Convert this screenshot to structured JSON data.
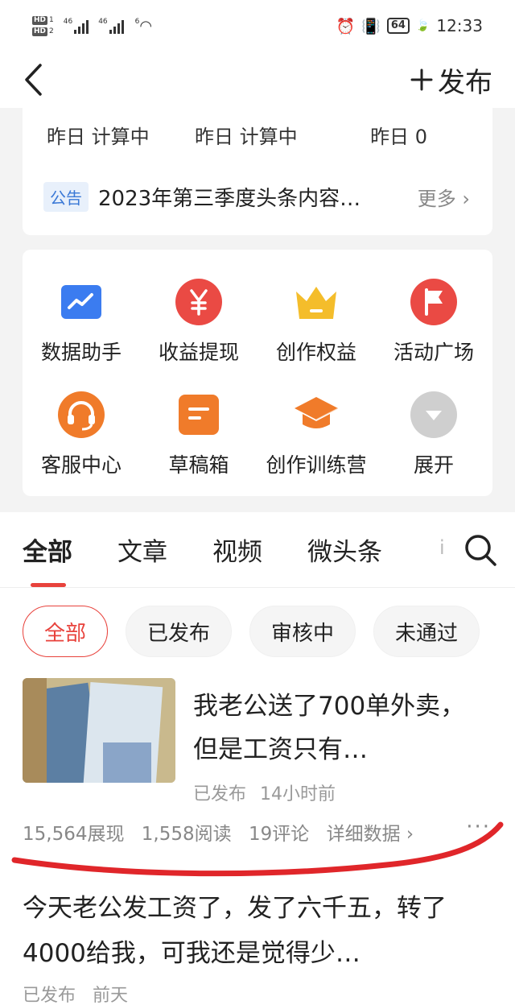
{
  "status_bar": {
    "hd1": "HD",
    "hd1_num": "1",
    "hd2": "HD",
    "hd2_num": "2",
    "sig1_label": "46",
    "sig2_label": "46",
    "wifi_label": "6",
    "battery": "64",
    "time": "12:33"
  },
  "nav": {
    "publish_label": "发布"
  },
  "stats": [
    {
      "label": "昨日 计算中"
    },
    {
      "label": "昨日 计算中"
    },
    {
      "label": "昨日 0"
    }
  ],
  "notice": {
    "tag": "公告",
    "text": "2023年第三季度头条内容…",
    "more": "更多"
  },
  "tools": [
    {
      "label": "数据助手",
      "icon": "chart-icon",
      "color": "#3b7cf0"
    },
    {
      "label": "收益提现",
      "icon": "yuan-icon",
      "color": "#ea4a44"
    },
    {
      "label": "创作权益",
      "icon": "crown-icon",
      "color": "#f4bd2b"
    },
    {
      "label": "活动广场",
      "icon": "flag-icon",
      "color": "#ea4a44"
    },
    {
      "label": "客服中心",
      "icon": "headset-icon",
      "color": "#f07b2a"
    },
    {
      "label": "草稿箱",
      "icon": "draft-icon",
      "color": "#f07b2a"
    },
    {
      "label": "创作训练营",
      "icon": "graduation-cap-icon",
      "color": "#f07b2a"
    },
    {
      "label": "展开",
      "icon": "expand-icon",
      "color": "#cfcfcf"
    }
  ],
  "tabs": [
    {
      "label": "全部",
      "active": true
    },
    {
      "label": "文章"
    },
    {
      "label": "视频"
    },
    {
      "label": "微头条"
    }
  ],
  "tab_fade": "i",
  "filters": [
    {
      "label": "全部",
      "active": true
    },
    {
      "label": "已发布"
    },
    {
      "label": "审核中"
    },
    {
      "label": "未通过"
    }
  ],
  "articles": [
    {
      "title": "我老公送了700单外卖，但是工资只有…",
      "status": "已发布",
      "time": "14小时前",
      "impressions": "15,564展现",
      "reads": "1,558阅读",
      "comments": "19评论",
      "details": "详细数据 ›"
    },
    {
      "title": "今天老公发工资了，发了六千五，转了4000给我，可我还是觉得少…",
      "status": "已发布",
      "time": "前天"
    }
  ],
  "colors": {
    "accent": "#e8423c",
    "annotation_line": "#e0262a"
  }
}
